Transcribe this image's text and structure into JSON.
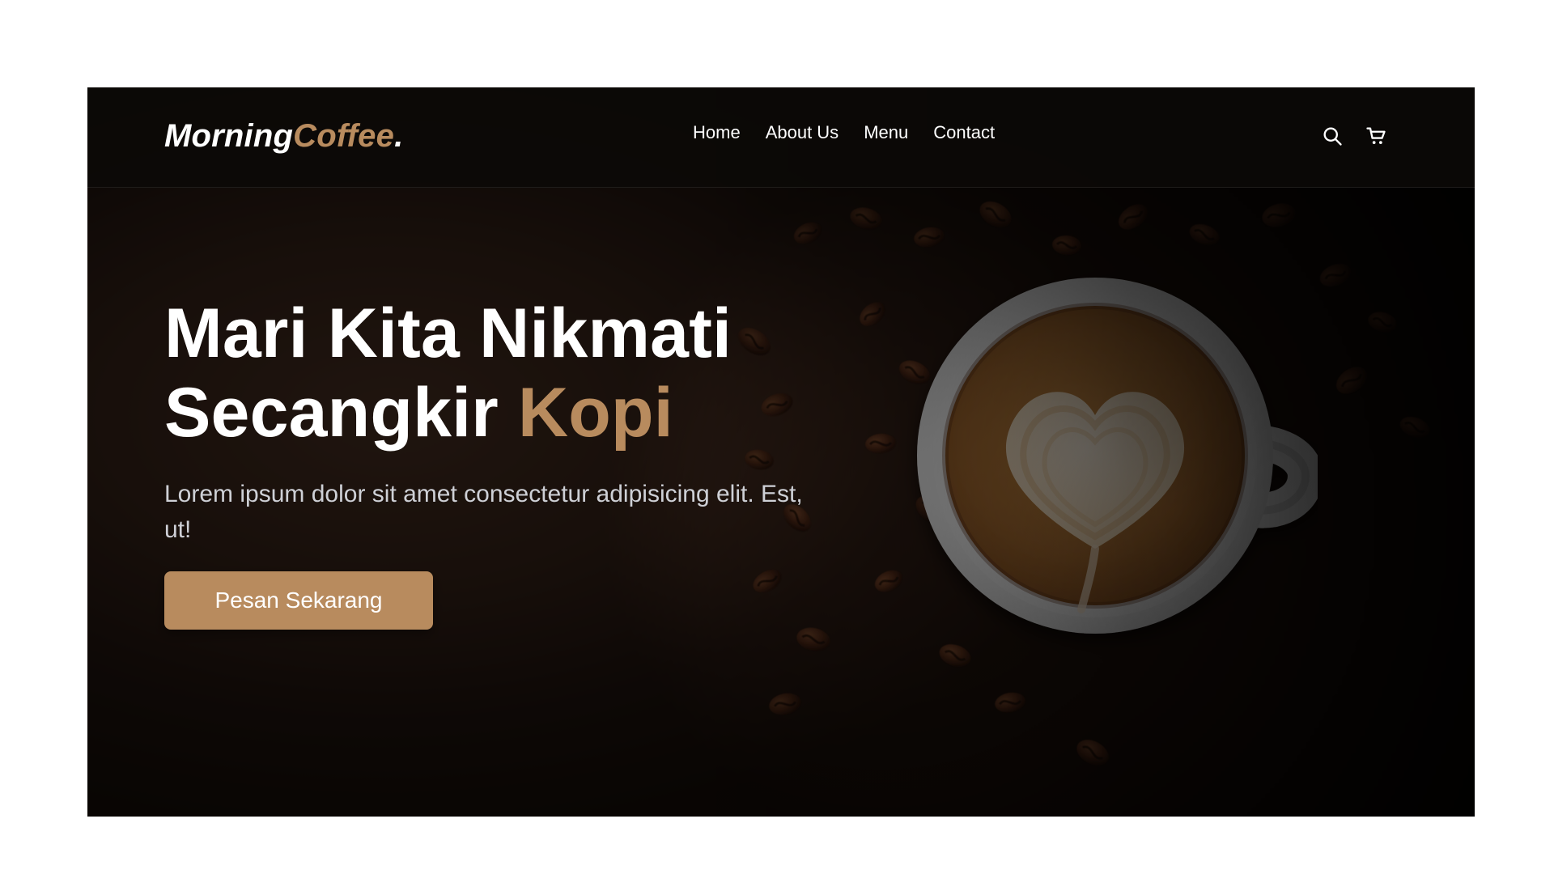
{
  "brand": {
    "part1": "Morning",
    "part2": "Coffee",
    "dot": ".",
    "accent_color": "#b88b5e"
  },
  "nav": {
    "items": [
      {
        "label": "Home"
      },
      {
        "label": "About Us"
      },
      {
        "label": "Menu"
      },
      {
        "label": "Contact"
      }
    ]
  },
  "header_icons": {
    "search": "search-icon",
    "cart": "cart-icon"
  },
  "hero": {
    "title_line1": "Mari Kita Nikmati",
    "title_line2_prefix": "Secangkir",
    "title_line2_accent": "Kopi",
    "subtitle": "Lorem ipsum dolor sit amet consectetur adipisicing elit. Est, ut!",
    "cta_label": "Pesan Sekarang"
  }
}
